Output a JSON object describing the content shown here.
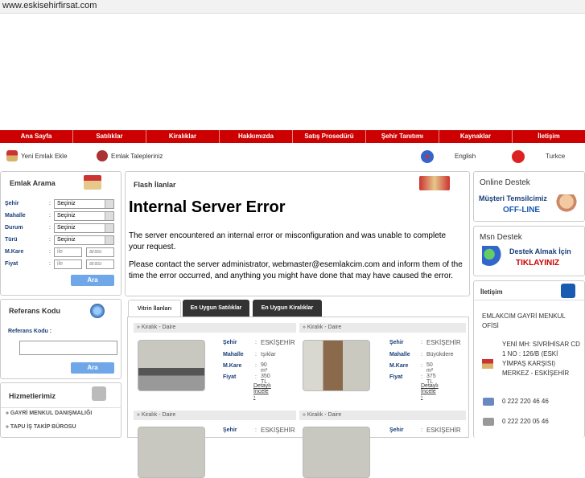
{
  "browser": {
    "url": "www.eskisehirfirsat.com"
  },
  "nav": [
    "Ana Sayfa",
    "Satılıklar",
    "Kiralıklar",
    "Hakkımızda",
    "Satış Prosedürü",
    "Şehir Tanıtımı",
    "Kaynaklar",
    "İletişim"
  ],
  "subbar": {
    "new_listing": "Yeni Emlak Ekle",
    "requests": "Emlak Talepleriniz",
    "english": "English",
    "turkish": "Turkce"
  },
  "search": {
    "title": "Emlak Arama",
    "rows": [
      {
        "label": "Şehir",
        "value": "Seçiniz"
      },
      {
        "label": "Mahalle",
        "value": "Seçiniz"
      },
      {
        "label": "Durum",
        "value": "Seçiniz"
      },
      {
        "label": "Türü",
        "value": "Seçiniz"
      }
    ],
    "mkare_label": "M.Kare",
    "fiyat_label": "Fiyat",
    "colon": ":",
    "ile": "ile",
    "arasi": "arası",
    "button": "Ara"
  },
  "reference": {
    "title": "Referans Kodu",
    "label": "Referans Kodu :",
    "button": "Ara"
  },
  "services": {
    "title": "Hizmetlerimiz",
    "items": [
      "GAYRİ MENKUL DANIŞMALIĞI",
      "TAPU İŞ TAKİP BÜROSU"
    ]
  },
  "flash": {
    "title": "Flash İlanlar",
    "error_title": "Internal Server Error",
    "error_p1": "The server encountered an internal error or misconfiguration and was unable to complete your request.",
    "error_p2": "Please contact the server administrator, webmaster@esemlakcim.com and inform them of the time the error occurred, and anything you might have done that may have caused the error."
  },
  "tabs": [
    "Vitrin İlanları",
    "En Uygun Satılıklar",
    "En Uygun Kiralıklar"
  ],
  "listings": {
    "headers": [
      "Kiralık - Daire",
      "Kiralık - Daire",
      "Kiralık - Daire",
      "Kiralık - Daire"
    ],
    "labels": {
      "sehir": "Şehir",
      "mahalle": "Mahalle",
      "mkare": "M.Kare",
      "fiyat": "Fiyat",
      "colon": ":",
      "detay": "Detaylı İncele"
    },
    "cards": [
      {
        "sehir": "ESKİŞEHİR",
        "mahalle": "Işıklar",
        "mkare": "90 m²",
        "fiyat": "350 TL"
      },
      {
        "sehir": "ESKİŞEHİR",
        "mahalle": "Büyükdere",
        "mkare": "50 m²",
        "fiyat": "375 TL"
      }
    ],
    "bottom_sehir": [
      "ESKİŞEHİR",
      "ESKİŞEHİR"
    ]
  },
  "support": {
    "online_title": "Online Destek",
    "online_line1": "Müşteri Temsilcimiz",
    "online_line2": "OFF-LINE",
    "msn_title": "Msn Destek",
    "msn_line1": "Destek Almak İçin",
    "msn_line2": "TIKLAYINIZ"
  },
  "contact": {
    "title": "İletişim",
    "company": "EMLAKCIM GAYRİ MENKUL OFİSİ",
    "address": "YENİ MH: SİVRİHİSAR CD 1 NO : 126/B (ESKİ YİMPAŞ KARŞISI) MERKEZ - ESKİŞEHİR",
    "phone": "0 222 220 46 46",
    "fax": "0 222 220 05 46"
  },
  "colors": {
    "nav_red": "#cc0000",
    "button_blue": "#6fa7e8",
    "tab_dark": "#333333"
  }
}
